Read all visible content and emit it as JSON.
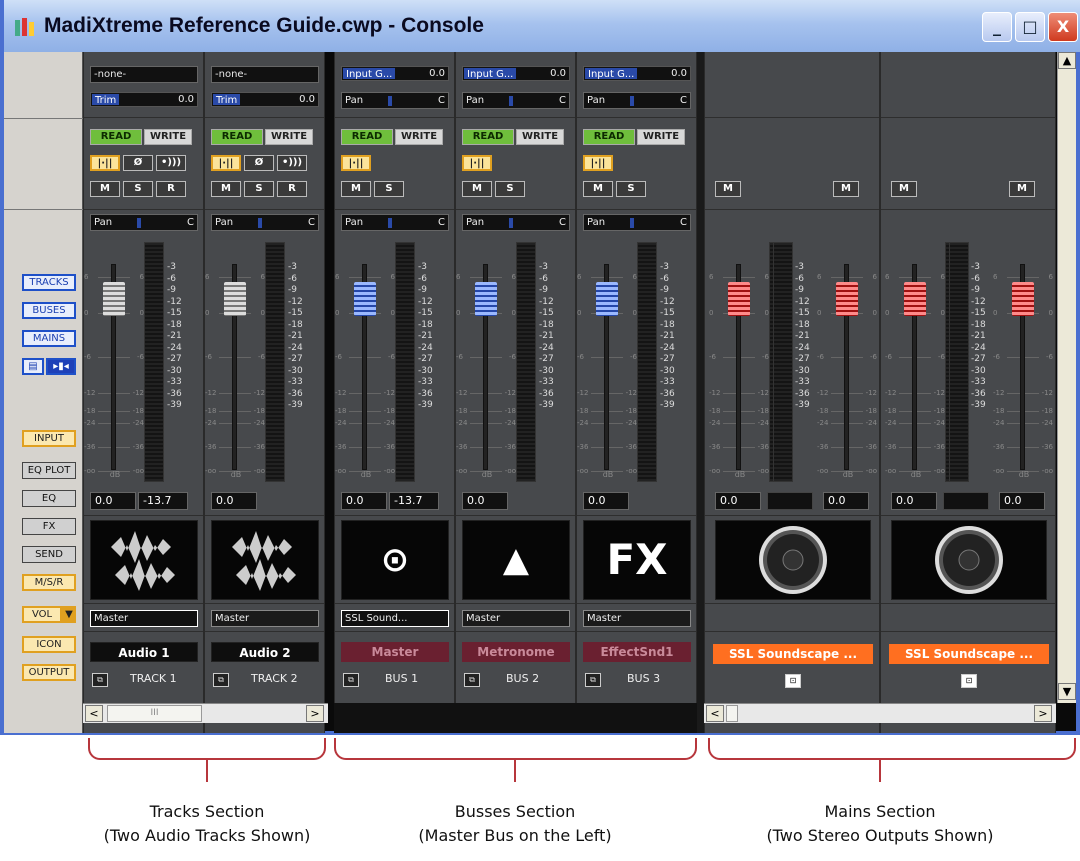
{
  "window": {
    "title": "MadiXtreme Reference Guide.cwp - Console",
    "min": "_",
    "max": "□",
    "close": "X"
  },
  "left_panel": {
    "view_buttons": [
      "TRACKS",
      "BUSES",
      "MAINS"
    ],
    "small_icons": [
      "▤",
      "▸▮◂"
    ],
    "module_buttons": [
      "INPUT",
      "EQ PLOT",
      "EQ",
      "FX",
      "SEND",
      "M/S/R",
      "VOL",
      "ICON",
      "OUTPUT"
    ],
    "vol_arrow": "▼"
  },
  "labels": {
    "read": "READ",
    "write": "WRITE",
    "pan": "Pan",
    "pan_val": "C",
    "mute": "M",
    "solo": "S",
    "rec": "R",
    "phase": "Ø",
    "db": "dB",
    "trim": "Trim",
    "trim_val": "0.0",
    "input_gain": "Input G...",
    "input_gain_val": "0.0",
    "none": "-none-"
  },
  "meter_scale": [
    "-3",
    "-6",
    "-9",
    "-12",
    "-15",
    "-18",
    "-21",
    "-24",
    "-27",
    "-30",
    "-33",
    "-36",
    "-39"
  ],
  "fader_ticks": [
    "6",
    "0",
    "-6",
    "-12",
    "-18",
    "-24",
    "-36",
    "-oo"
  ],
  "tracks": [
    {
      "name": "Audio 1",
      "type": "TRACK 1",
      "output": "Master",
      "vol": "0.0",
      "peak": "-13.7"
    },
    {
      "name": "Audio 2",
      "type": "TRACK 2",
      "output": "Master",
      "vol": "0.0",
      "peak": ""
    }
  ],
  "buses": [
    {
      "name": "Master",
      "type": "BUS 1",
      "output": "SSL Sound...",
      "vol": "0.0",
      "peak": "-13.7",
      "icon": "⊙"
    },
    {
      "name": "Metronome",
      "type": "BUS 2",
      "output": "Master",
      "vol": "0.0",
      "peak": "",
      "icon": "▲"
    },
    {
      "name": "EffectSnd1",
      "type": "BUS 3",
      "output": "Master",
      "vol": "0.0",
      "peak": "",
      "icon": "FX"
    }
  ],
  "mains": [
    {
      "name": "SSL Soundscape ...",
      "vol_l": "0.0",
      "vol_r": "0.0"
    },
    {
      "name": "SSL Soundscape ...",
      "vol_l": "0.0",
      "vol_r": "0.0"
    }
  ],
  "scroll": {
    "left": "<",
    "right": ">",
    "thumb": "III"
  },
  "captions": [
    {
      "line1": "Tracks Section",
      "line2": "(Two Audio Tracks Shown)"
    },
    {
      "line1": "Busses Section",
      "line2": "(Master Bus on the Left)"
    },
    {
      "line1": "Mains Section",
      "line2": "(Two Stereo Outputs Shown)"
    }
  ],
  "colors": {
    "read": "#6fbe3c",
    "bus_name": "#6a2030",
    "main_name": "#ff6f20",
    "bracket": "#b7363c"
  }
}
